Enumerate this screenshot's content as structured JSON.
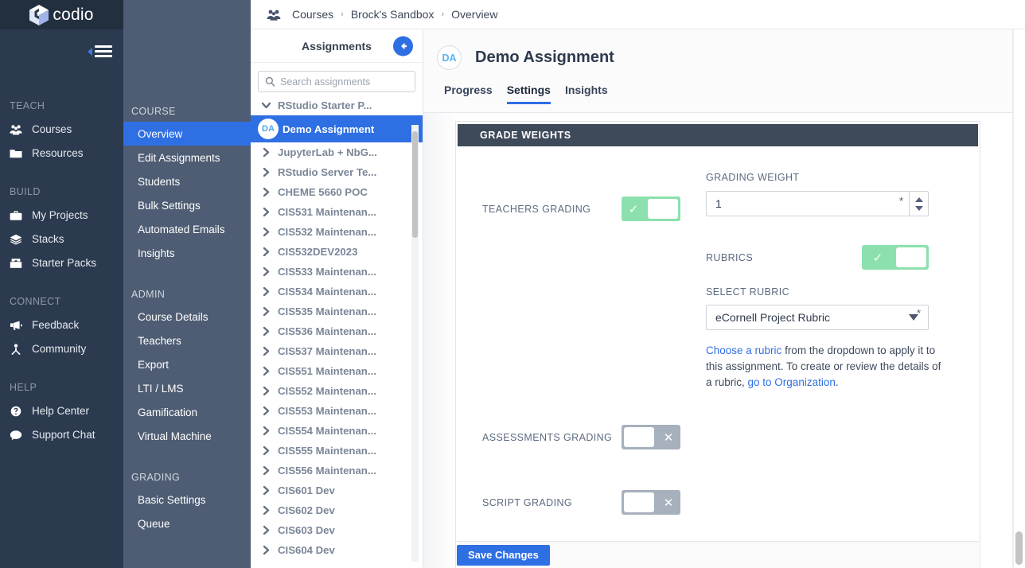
{
  "brand": {
    "name": "codio",
    "logo_icon": "codio-cube-logo",
    "accent_blue": "#2f6fe4",
    "rail_bg": "#2b3a4f",
    "subnav_bg": "#4e5d73",
    "toggle_on": "#8ce0ad",
    "toggle_off": "#a7b0bd",
    "card_header_bg": "#3e4a5a"
  },
  "rail": {
    "menu_toggle_icon": "hamburger-menu-icon",
    "groups": [
      {
        "label": "TEACH",
        "items": [
          {
            "label": "Courses",
            "icon": "people-group-icon"
          },
          {
            "label": "Resources",
            "icon": "folder-icon"
          }
        ]
      },
      {
        "label": "BUILD",
        "items": [
          {
            "label": "My Projects",
            "icon": "briefcase-icon"
          },
          {
            "label": "Stacks",
            "icon": "layers-icon"
          },
          {
            "label": "Starter Packs",
            "icon": "package-icon"
          }
        ]
      },
      {
        "label": "CONNECT",
        "items": [
          {
            "label": "Feedback",
            "icon": "megaphone-icon"
          },
          {
            "label": "Community",
            "icon": "person-network-icon"
          }
        ]
      },
      {
        "label": "HELP",
        "items": [
          {
            "label": "Help Center",
            "icon": "question-circle-icon"
          },
          {
            "label": "Support Chat",
            "icon": "chat-bubble-icon"
          }
        ]
      }
    ]
  },
  "subnav": {
    "groups": [
      {
        "label": "COURSE",
        "items": [
          {
            "label": "Overview",
            "active": true
          },
          {
            "label": "Edit Assignments",
            "active": false
          },
          {
            "label": "Students",
            "active": false
          },
          {
            "label": "Bulk Settings",
            "active": false
          },
          {
            "label": "Automated Emails",
            "active": false
          },
          {
            "label": "Insights",
            "active": false
          }
        ]
      },
      {
        "label": "ADMIN",
        "items": [
          {
            "label": "Course Details",
            "active": false
          },
          {
            "label": "Teachers",
            "active": false
          },
          {
            "label": "Export",
            "active": false
          },
          {
            "label": "LTI / LMS",
            "active": false
          },
          {
            "label": "Gamification",
            "active": false
          },
          {
            "label": "Virtual Machine",
            "active": false
          }
        ]
      },
      {
        "label": "GRADING",
        "items": [
          {
            "label": "Basic Settings",
            "active": false
          },
          {
            "label": "Queue",
            "active": false
          }
        ]
      }
    ]
  },
  "breadcrumb": {
    "icon": "people-group-icon",
    "separator": "›",
    "items": [
      "Courses",
      "Brock's Sandbox",
      "Overview"
    ]
  },
  "assignments_panel": {
    "title": "Assignments",
    "collapse_icon": "arrow-left-circle-icon",
    "search": {
      "placeholder": "Search assignments",
      "value": "",
      "icon": "search-icon"
    },
    "items": [
      {
        "label": "RStudio Starter P...",
        "icon": "chevron-down-icon",
        "selected": false
      },
      {
        "label": "Demo Assignment",
        "icon": "DA",
        "selected": true
      },
      {
        "label": "JupyterLab + NbG...",
        "icon": "chevron-right-icon",
        "selected": false
      },
      {
        "label": "RStudio Server Te...",
        "icon": "chevron-right-icon",
        "selected": false
      },
      {
        "label": "CHEME 5660 POC",
        "icon": "chevron-right-icon",
        "selected": false
      },
      {
        "label": "CIS531 Maintenan...",
        "icon": "chevron-right-icon",
        "selected": false
      },
      {
        "label": "CIS532 Maintenan...",
        "icon": "chevron-right-icon",
        "selected": false
      },
      {
        "label": "CIS532DEV2023",
        "icon": "chevron-right-icon",
        "selected": false
      },
      {
        "label": "CIS533 Maintenan...",
        "icon": "chevron-right-icon",
        "selected": false
      },
      {
        "label": "CIS534 Maintenan...",
        "icon": "chevron-right-icon",
        "selected": false
      },
      {
        "label": "CIS535 Maintenan...",
        "icon": "chevron-right-icon",
        "selected": false
      },
      {
        "label": "CIS536 Maintenan...",
        "icon": "chevron-right-icon",
        "selected": false
      },
      {
        "label": "CIS537 Maintenan...",
        "icon": "chevron-right-icon",
        "selected": false
      },
      {
        "label": "CIS551 Maintenan...",
        "icon": "chevron-right-icon",
        "selected": false
      },
      {
        "label": "CIS552 Maintenan...",
        "icon": "chevron-right-icon",
        "selected": false
      },
      {
        "label": "CIS553 Maintenan...",
        "icon": "chevron-right-icon",
        "selected": false
      },
      {
        "label": "CIS554 Maintenan...",
        "icon": "chevron-right-icon",
        "selected": false
      },
      {
        "label": "CIS555 Maintenan...",
        "icon": "chevron-right-icon",
        "selected": false
      },
      {
        "label": "CIS556 Maintenan...",
        "icon": "chevron-right-icon",
        "selected": false
      },
      {
        "label": "CIS601 Dev",
        "icon": "chevron-right-icon",
        "selected": false
      },
      {
        "label": "CIS602 Dev",
        "icon": "chevron-right-icon",
        "selected": false
      },
      {
        "label": "CIS603 Dev",
        "icon": "chevron-right-icon",
        "selected": false
      },
      {
        "label": "CIS604 Dev",
        "icon": "chevron-right-icon",
        "selected": false
      }
    ]
  },
  "assignment": {
    "badge": "DA",
    "title": "Demo Assignment",
    "tabs": [
      {
        "label": "Progress",
        "active": false
      },
      {
        "label": "Settings",
        "active": true
      },
      {
        "label": "Insights",
        "active": false
      }
    ]
  },
  "grade_weights": {
    "panel_title": "GRADE WEIGHTS",
    "teachers_grading": {
      "label": "TEACHERS GRADING",
      "state": "on",
      "on_mark": "✓",
      "off_mark": "✕"
    },
    "grading_weight": {
      "label": "GRADING WEIGHT",
      "value": "1",
      "required_mark": "*",
      "up_icon": "caret-up-icon",
      "down_icon": "caret-down-icon"
    },
    "rubrics": {
      "label": "RUBRICS",
      "state": "on",
      "on_mark": "✓"
    },
    "select_rubric": {
      "label": "SELECT RUBRIC",
      "value": "eCornell Project Rubric",
      "required_mark": "*",
      "caret_icon": "caret-down-icon"
    },
    "rubric_help": {
      "link1": "Choose a rubric",
      "mid": " from the dropdown to apply it to this assignment. To create or review the details of a rubric, ",
      "link2": "go to Organization",
      "end": "."
    },
    "assessments_grading": {
      "label": "ASSESSMENTS GRADING",
      "state": "off",
      "off_mark": "✕"
    },
    "script_grading": {
      "label": "SCRIPT GRADING",
      "state": "off",
      "off_mark": "✕"
    },
    "save_label": "Save Changes"
  }
}
